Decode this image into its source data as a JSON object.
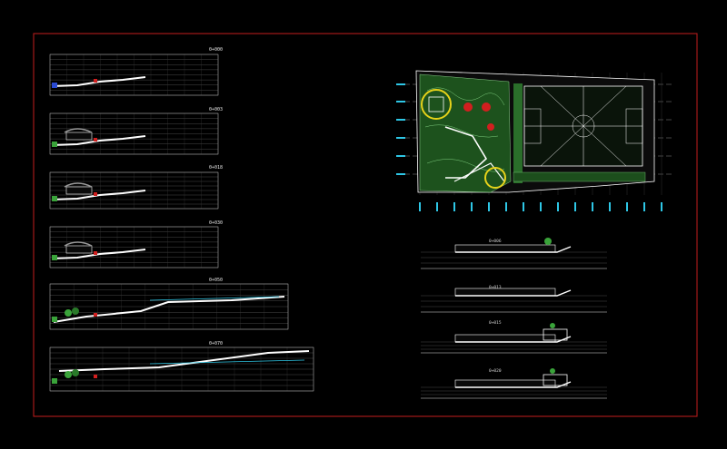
{
  "drawing": {
    "frame_color": "#c41e1e",
    "background": "#000000",
    "line_color": "#ffffff",
    "accent_cyan": "#2ec7e6",
    "accent_green": "#3aa33a",
    "accent_red": "#d21f1f",
    "accent_yellow": "#e6d21a"
  },
  "left_sections": {
    "labels": [
      "0+000",
      "0+003",
      "0+018",
      "0+030",
      "0+050",
      "0+070"
    ]
  },
  "right_sections": {
    "labels": [
      "0+006",
      "0+013",
      "0+015",
      "0+020"
    ]
  }
}
